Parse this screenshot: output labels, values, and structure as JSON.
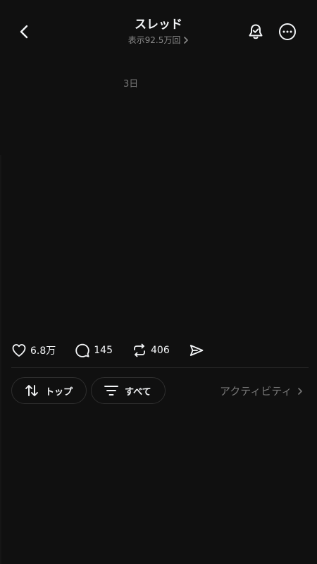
{
  "header": {
    "title": "スレッド",
    "views": "表示92.5万回",
    "icons": {
      "back": "chevron-left-icon",
      "notify": "bell-check-icon",
      "more": "more-horizontal-icon",
      "views_arrow": "chevron-right-icon"
    }
  },
  "post": {
    "timestamp": "3日"
  },
  "actions": {
    "likes": "6.8万",
    "replies": "145",
    "reposts": "406",
    "icons": [
      "heart-icon",
      "comment-icon",
      "repost-icon",
      "send-icon"
    ]
  },
  "filters": {
    "sort_label": "トップ",
    "filter_label": "すべて",
    "activity_label": "アクティビティ"
  },
  "colors": {
    "background": "#101010",
    "text_primary": "#f3f5f7",
    "text_secondary": "#777777",
    "border": "#2e2e2e"
  }
}
